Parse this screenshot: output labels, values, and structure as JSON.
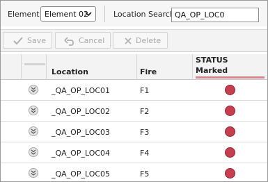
{
  "filters": {
    "element_label": "Element",
    "element_value": "Element 02",
    "location_search_label": "Location Search",
    "location_search_value": "QA_OP_LOC0"
  },
  "toolbar": {
    "save_label": "Save",
    "cancel_label": "Cancel",
    "delete_label": "Delete"
  },
  "grid": {
    "columns": {
      "location": "Location",
      "fire": "Fire",
      "status_line1": "STATUS",
      "status_line2": "Marked"
    },
    "rows": [
      {
        "location": "_QA_OP_LOC01",
        "fire": "F1"
      },
      {
        "location": "_QA_OP_LOC02",
        "fire": "F2"
      },
      {
        "location": "_QA_OP_LOC03",
        "fire": "F3"
      },
      {
        "location": "_QA_OP_LOC04",
        "fire": "F4"
      },
      {
        "location": "_QA_OP_LOC05",
        "fire": "F5"
      }
    ]
  },
  "colors": {
    "status_marked": "#c73e4f",
    "status_underline": "#d9848d"
  }
}
